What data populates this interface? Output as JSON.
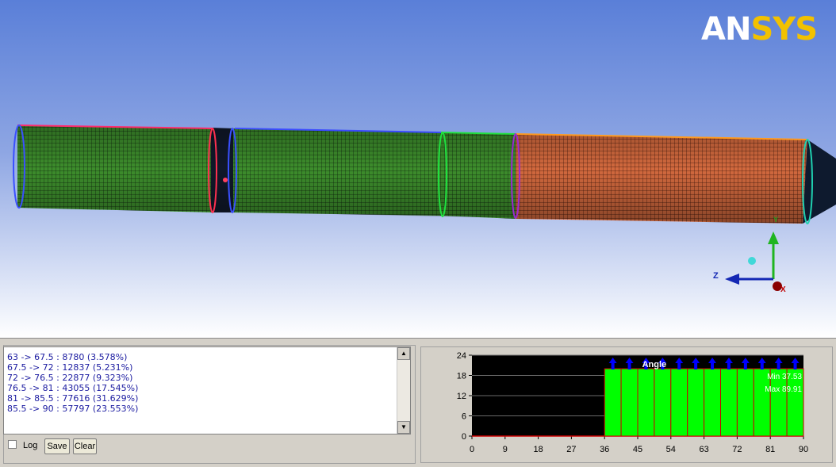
{
  "viewport": {
    "logo": {
      "part1": "AN",
      "part2": "SYS"
    },
    "triad": {
      "x": "X",
      "y": "Y",
      "z": "Z"
    },
    "colors": {
      "section_green": "#3a8a2a",
      "section_orange": "#d0663c",
      "mesh_line": "#1a1a1a"
    }
  },
  "stats_list": {
    "lines": [
      "63 -> 67.5 : 8780 (3.578%)",
      "67.5 -> 72 : 12837 (5.231%)",
      "72 -> 76.5 : 22877 (9.323%)",
      "76.5 -> 81 : 43055 (17.545%)",
      "81 -> 85.5 : 77616 (31.629%)",
      "85.5 -> 90 : 57797 (23.553%)"
    ],
    "scroll_up": "▲",
    "scroll_down": "▼"
  },
  "controls": {
    "log_label": "Log",
    "log_checked": false,
    "save_label": "Save",
    "clear_label": "Clear"
  },
  "chart_data": {
    "type": "bar",
    "title": "Angle",
    "min_label": "Min 37.53",
    "max_label": "Max 89.91",
    "x_ticks": [
      0,
      9,
      18,
      27,
      36,
      45,
      54,
      63,
      72,
      81,
      90
    ],
    "y_ticks": [
      0,
      6,
      12,
      18,
      24
    ],
    "xlim": [
      0,
      90
    ],
    "ylim": [
      0,
      24
    ],
    "bin_edges": [
      36,
      40.5,
      45,
      49.5,
      54,
      58.5,
      63,
      67.5,
      72,
      76.5,
      81,
      85.5,
      90
    ],
    "values": [
      20,
      20,
      20,
      20,
      20,
      20,
      20,
      20,
      20,
      20,
      20,
      20
    ],
    "markers_x": [
      38.25,
      42.75,
      47.25,
      51.75,
      56.25,
      60.75,
      65.25,
      69.75,
      74.25,
      78.75,
      83.25,
      87.75
    ],
    "colors": {
      "bar": "#00ff00",
      "bar_edge": "#cc0000",
      "background": "#000000",
      "marker": "#0000ff",
      "grid": "#6a6a6a"
    }
  }
}
